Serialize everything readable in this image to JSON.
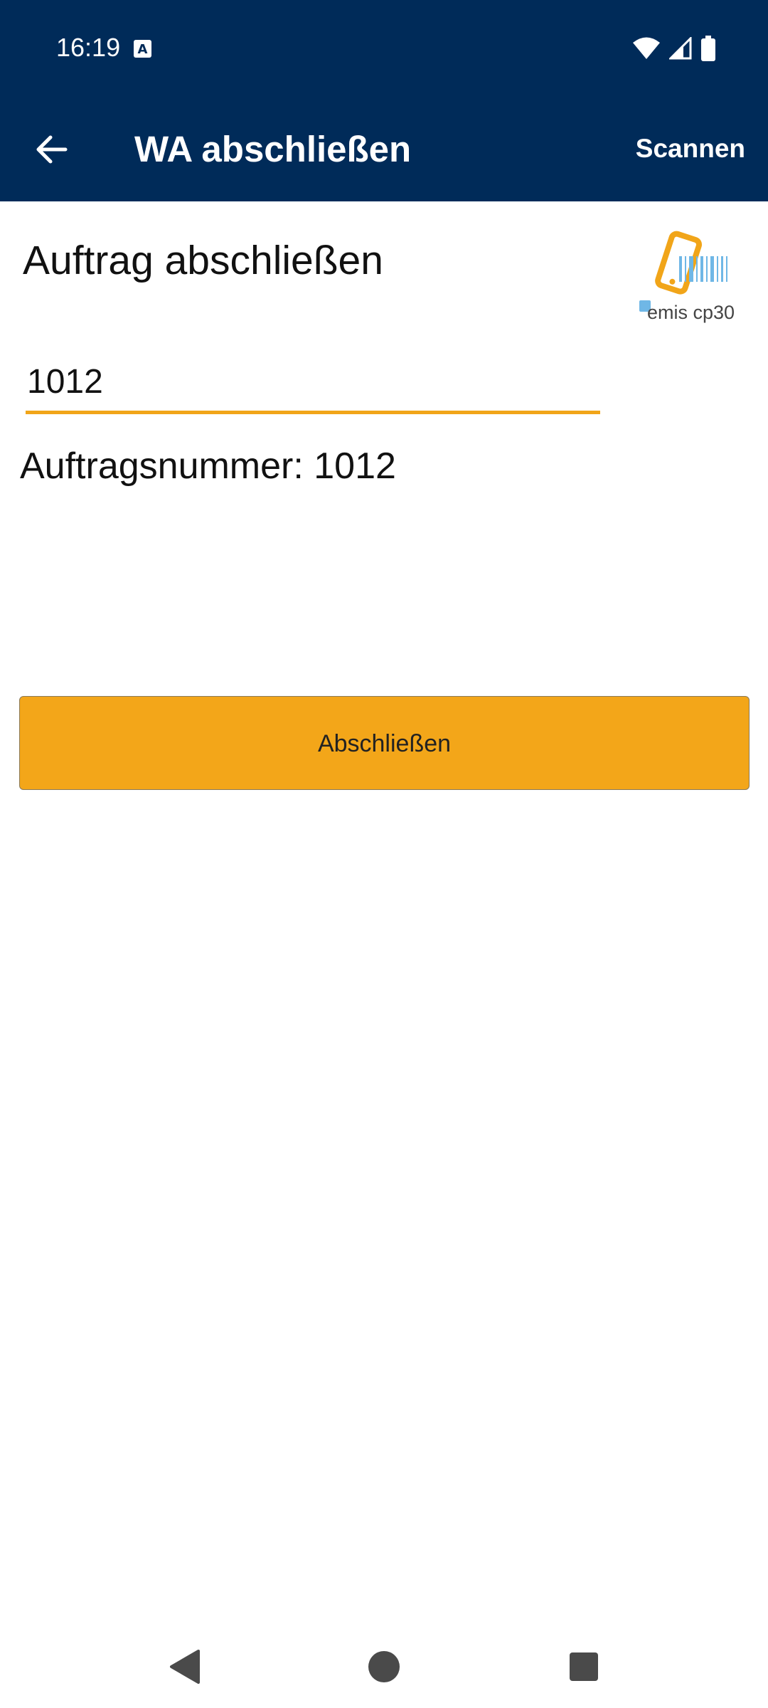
{
  "status_bar": {
    "time": "16:19",
    "icons": [
      "text-a-icon",
      "wifi-icon",
      "cell-signal-icon",
      "battery-icon"
    ]
  },
  "toolbar": {
    "back_icon": "arrow-left-icon",
    "title": "WA abschließen",
    "action_label": "Scannen"
  },
  "main": {
    "heading": "Auftrag abschließen",
    "logo_text": "emis cp30",
    "order_input_value": "1012",
    "order_number_text": "Auftragsnummer: 1012",
    "close_button_label": "Abschließen"
  },
  "nav_bar": {
    "icons": [
      "nav-back-icon",
      "nav-home-icon",
      "nav-recents-icon"
    ]
  },
  "colors": {
    "header": "#002b59",
    "accent": "#f3a619",
    "logo_blue": "#6fb7e6"
  }
}
